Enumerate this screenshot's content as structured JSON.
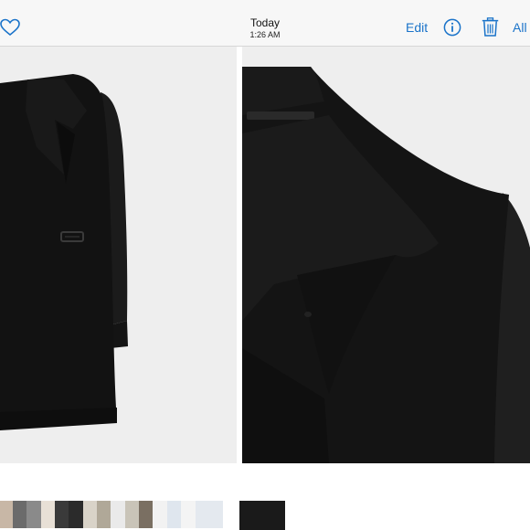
{
  "header": {
    "title": "Today",
    "subtitle": "1:26 AM",
    "edit_label": "Edit",
    "all_label": "All",
    "accent": "#1a73c9"
  },
  "icons": {
    "favorite": "heart-icon",
    "info": "info-icon",
    "delete": "trash-icon"
  },
  "photos": {
    "left": "coat-full-photo",
    "right": "coat-collar-closeup-photo"
  },
  "thumbnails": {
    "count": 15,
    "selected_index": 14
  }
}
